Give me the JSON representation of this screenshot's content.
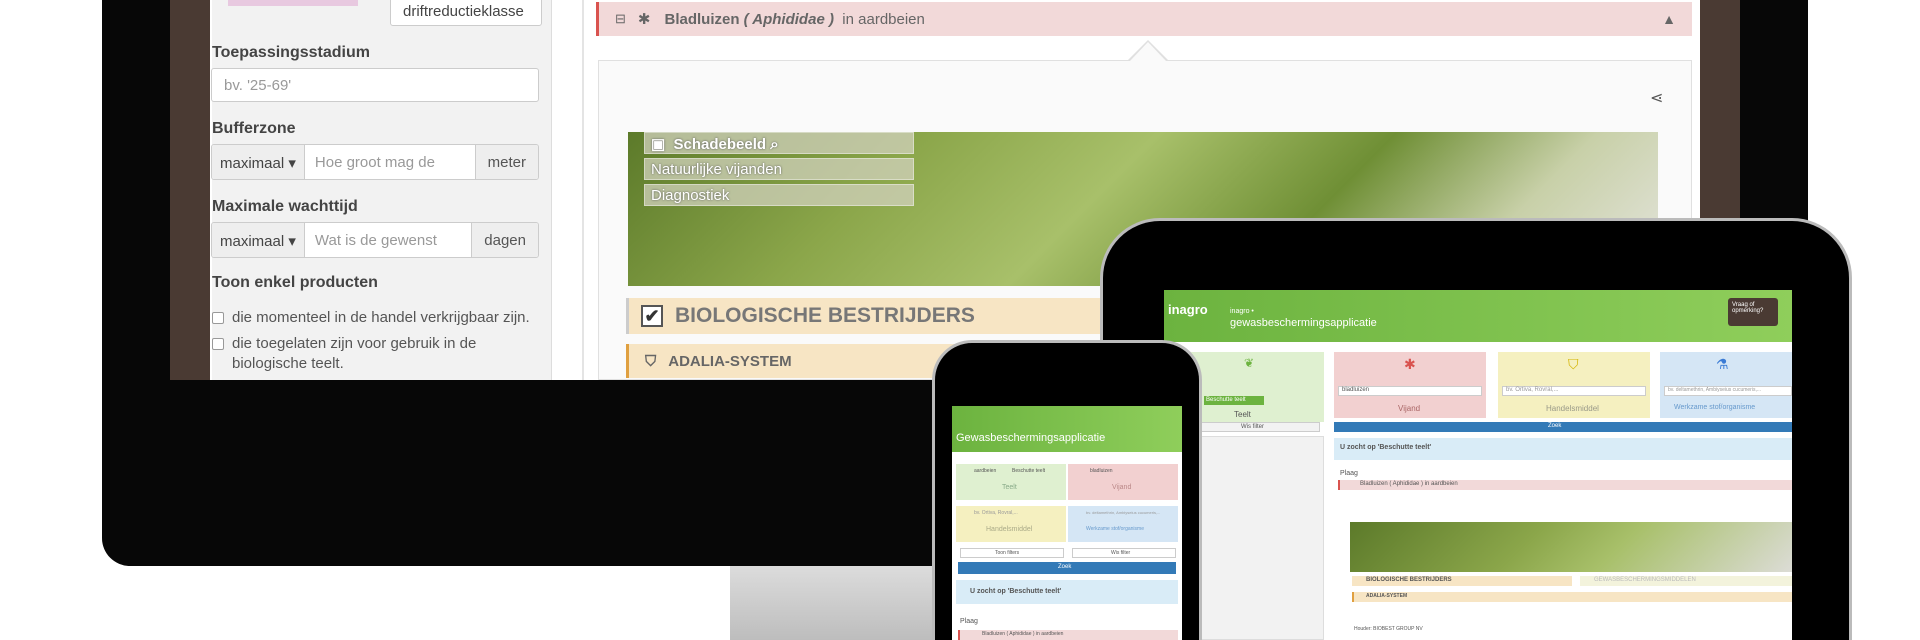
{
  "desktop": {
    "sidebar": {
      "drift_button": "driftreductieklasse",
      "stage_label": "Toepassingsstadium",
      "stage_placeholder": "bv. '25-69'",
      "buffer_label": "Bufferzone",
      "buffer_select": "maximaal",
      "buffer_placeholder": "Hoe groot mag de",
      "buffer_unit": "meter",
      "wait_label": "Maximale wachttijd",
      "wait_select": "maximaal",
      "wait_placeholder": "Wat is de gewenst",
      "wait_unit": "dagen",
      "show_label": "Toon enkel producten",
      "check1": "die momenteel in de handel verkrijgbaar zijn.",
      "check2_line1": "die toegelaten zijn voor gebruik in de",
      "check2_line2": "biologische teelt."
    },
    "pest": {
      "name": "Bladluizen",
      "latin": "( Aphididae )",
      "context": "in aardbeien"
    },
    "image_tabs": [
      "Schadebeeld",
      "Natuurlijke vijanden",
      "Diagnostiek"
    ],
    "bio_title": "BIOLOGISCHE BESTRIJDERS",
    "product": "ADALIA-SYSTEM"
  },
  "tablet": {
    "logo": "inagro",
    "header_small": "inagro •",
    "header_title": "gewasbeschermingsapplicatie",
    "feedback": "Vraag of opmerking?",
    "cards": [
      "Teelt",
      "Vijand",
      "Handelsmiddel",
      "Werkzame stof/organisme"
    ],
    "card_inputs": [
      "",
      "bladluizen",
      "bv. Ortiva, Rovral,...",
      "bv. deltamethrin, Ambiyseius cucumeris,..."
    ],
    "zoek": "Zoek",
    "search_note": "U zocht op 'Beschutte teelt'",
    "plaag": "Plaag",
    "pest": "Bladluizen ( Aphididae ) in aardbeien",
    "bio": "BIOLOGISCHE BESTRIJDERS",
    "gewas": "GEWASBESCHERMINGSMIDDELEN",
    "product": "ADALIA-SYSTEM",
    "houder": "Houder: BIOBEST GROUP NV",
    "filter_btn": "Wis filter",
    "beschutte": "Beschutte teelt"
  },
  "phone": {
    "title": "Gewasbeschermingsapplicatie",
    "teelt_value": "aardbeien",
    "teelt_select": "Beschutte teelt",
    "teelt": "Teelt",
    "vijand_value": "bladluizen",
    "vijand": "Vijand",
    "handel_ph": "bv. Ortiva, Rovral,...",
    "handel": "Handelsmiddel",
    "werk_ph": "bv. deltamethrin, Ambiyseius cucumeris,...",
    "werk": "Werkzame stof/organisme",
    "toon": "Toon filters",
    "wis": "Wis filter",
    "zoek": "Zoek",
    "search_note": "U zocht op 'Beschutte teelt'",
    "plaag": "Plaag",
    "pest": "Bladluizen ( Aphididae ) in aardbeien"
  },
  "colors": {
    "green": "#6cb33f",
    "pest": "#f2d9d9",
    "bio": "#f7e5c4",
    "brown": "#4a3a33"
  }
}
